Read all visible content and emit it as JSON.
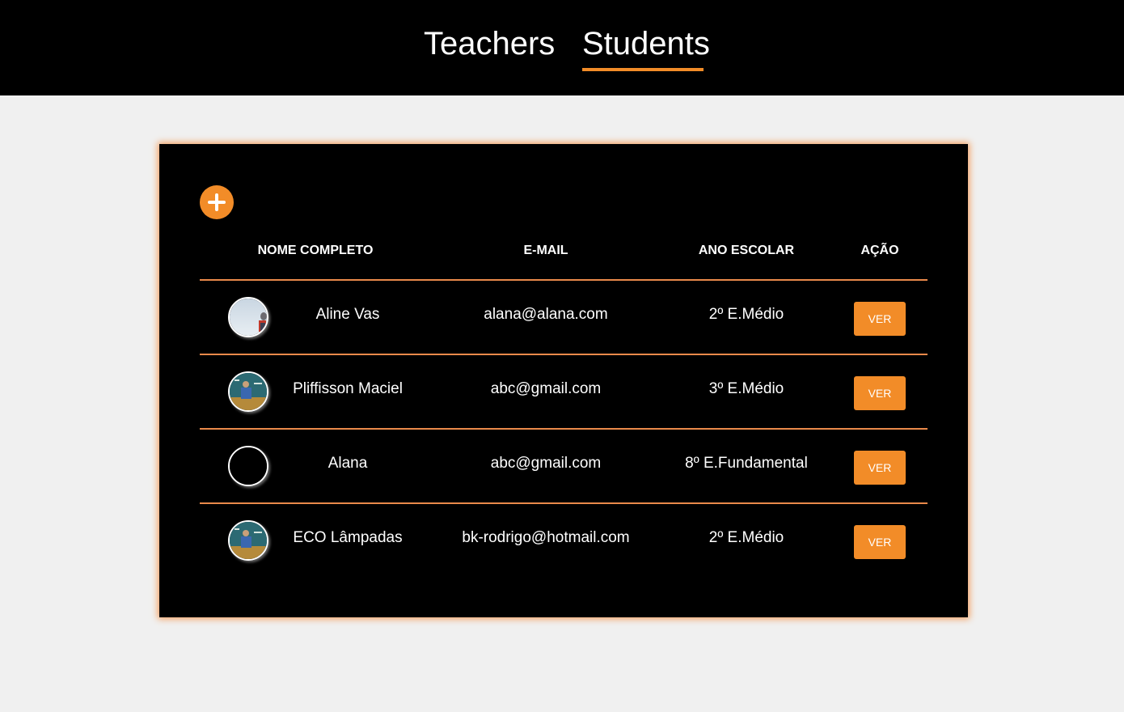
{
  "nav": {
    "tabs": [
      {
        "label": "Teachers",
        "active": false
      },
      {
        "label": "Students",
        "active": true
      }
    ]
  },
  "colors": {
    "accent": "#f28c28",
    "panel": "#000000",
    "background": "#f0f0f0"
  },
  "students": {
    "add_icon": "plus-icon",
    "columns": [
      "NOME COMPLETO",
      "E-MAIL",
      "ANO ESCOLAR",
      "AÇÃO"
    ],
    "rows": [
      {
        "name": "Aline Vas",
        "email": "alana@alana.com",
        "year": "2º E.Médio",
        "action": "VER",
        "avatar": "photo-sky"
      },
      {
        "name": "Pliffisson Maciel",
        "email": "abc@gmail.com",
        "year": "3º E.Médio",
        "action": "VER",
        "avatar": "photo-classroom"
      },
      {
        "name": "Alana",
        "email": "abc@gmail.com",
        "year": "8º E.Fundamental",
        "action": "VER",
        "avatar": "empty"
      },
      {
        "name": "ECO Lâmpadas",
        "email": "bk-rodrigo@hotmail.com",
        "year": "2º E.Médio",
        "action": "VER",
        "avatar": "photo-classroom"
      }
    ]
  }
}
